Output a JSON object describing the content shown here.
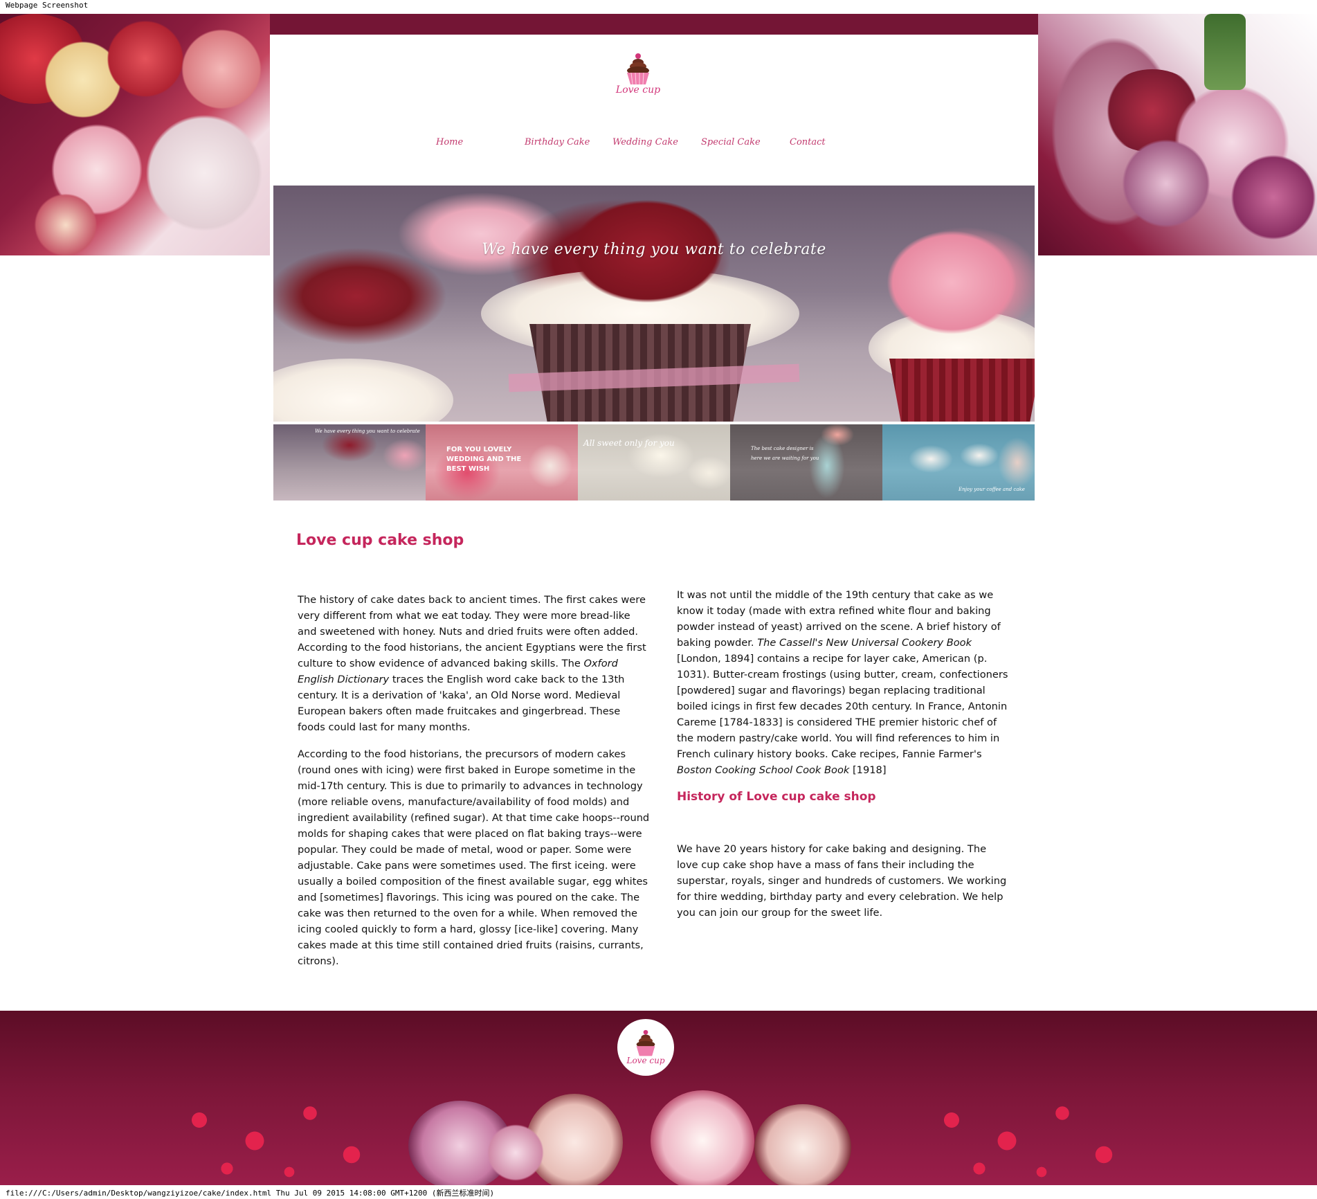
{
  "browser": {
    "header_text": "Webpage Screenshot",
    "footer_text": "file:///C:/Users/admin/Desktop/wangziyizoe/cake/index.html Thu Jul 09 2015 14:08:00 GMT+1200 (新西兰标准时间)"
  },
  "brand": {
    "logo_text": "Love cup",
    "footer_logo_text": "Love cup",
    "accent_color": "#c5265c",
    "band_color": "#741535"
  },
  "nav": {
    "items": [
      {
        "label": "Home"
      },
      {
        "label": "Birthday Cake"
      },
      {
        "label": "Wedding Cake"
      },
      {
        "label": "Special Cake"
      },
      {
        "label": "Contact"
      }
    ]
  },
  "hero": {
    "caption": "We have every thing you want to celebrate"
  },
  "thumbnails": [
    {
      "caption": "We have every thing you want to celebrate"
    },
    {
      "caption": "FOR YOU LOVELY WEDDING AND THE BEST WISH"
    },
    {
      "caption": "All sweet only for you"
    },
    {
      "caption": "The best cake designer is here we are waiting for you"
    },
    {
      "caption": "Enjoy your coffee and cake"
    }
  ],
  "main": {
    "title": "Love cup cake shop",
    "left_paragraphs": [
      {
        "before": "The history of cake dates back to ancient times. The first cakes were very different from what we eat today. They were more bread-like and sweetened with honey. Nuts and dried fruits were often added. According to the food historians, the ancient Egyptians were the first culture to show evidence of advanced baking skills. The ",
        "italic": "Oxford English Dictionary",
        "after": " traces the English word cake back to the 13th century. It is a derivation of 'kaka', an Old Norse word. Medieval European bakers often made fruitcakes and gingerbread. These foods could last for many months."
      },
      {
        "text": "According to the food historians, the precursors of modern cakes (round ones with icing) were first baked in Europe sometime in the mid-17th century. This is due to primarily to advances in technology (more reliable ovens, manufacture/availability of food molds) and ingredient availability (refined sugar). At that time cake hoops--round molds for shaping cakes that were placed on flat baking trays--were popular. They could be made of metal, wood or paper. Some were adjustable. Cake pans were sometimes used. The first iceing. were usually a boiled composition of the finest available sugar, egg whites and [sometimes] flavorings. This icing was poured on the cake. The cake was then returned to the oven for a while. When removed the icing cooled quickly to form a hard, glossy [ice-like] covering. Many cakes made at this time still contained dried fruits (raisins, currants, citrons)."
      }
    ],
    "right_paragraph": {
      "part1": "It was not until the middle of the 19th century that cake as we know it today (made with extra refined white flour and baking powder instead of yeast) arrived on the scene. A brief history of baking powder. ",
      "italic1": "The Cassell's New Universal Cookery Book",
      "part2": " [London, 1894] contains a recipe for layer cake, American (p. 1031). Butter-cream frostings (using butter, cream, confectioners [powdered] sugar and flavorings) began replacing traditional boiled icings in first few decades 20th century. In France, Antonin Careme [1784-1833] is considered THE premier historic chef of the modern pastry/cake world. You will find references to him in French culinary history books. Cake recipes, Fannie Farmer's ",
      "italic2": "Boston Cooking School Cook Book",
      "part3": " [1918]"
    },
    "history_title": "History of Love cup cake shop",
    "history_text": "We have 20 years history for cake baking and designing. The love cup cake shop have a mass of fans their including the superstar, royals, singer and hundreds of customers. We working for thire wedding, birthday party and every celebration. We help you can join our group for the sweet life."
  }
}
